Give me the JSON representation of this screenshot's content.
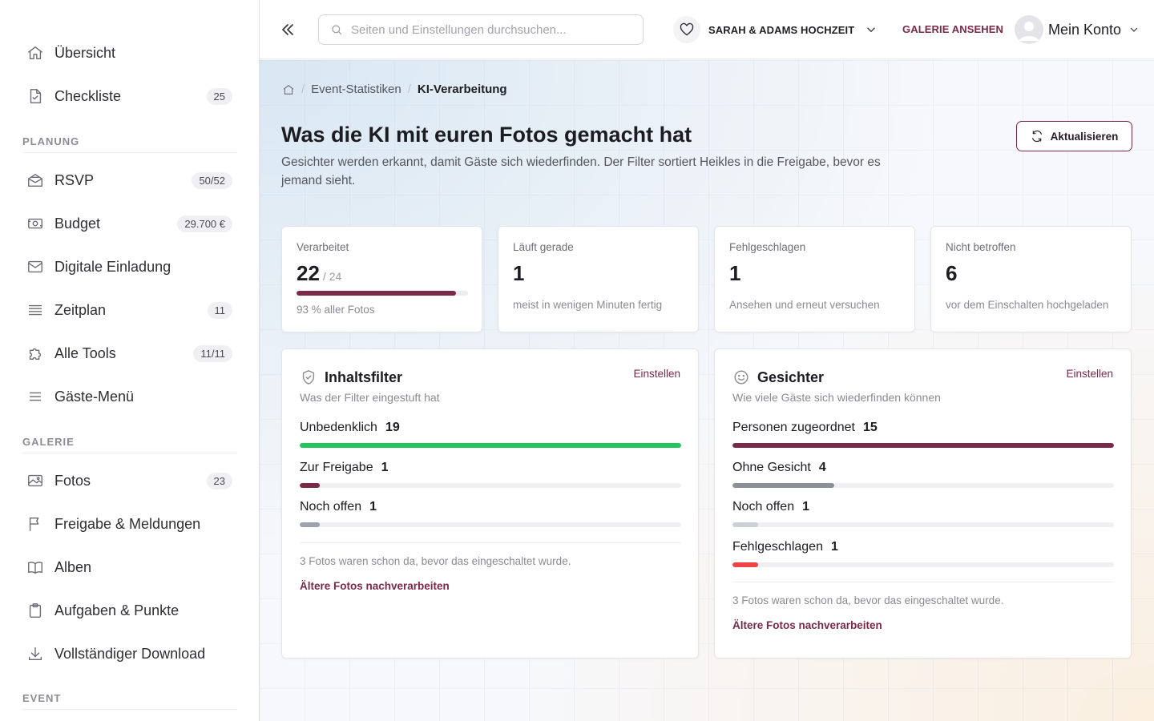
{
  "sidebar": {
    "items_top": [
      {
        "label": "Übersicht",
        "icon": "home-icon",
        "badge": ""
      },
      {
        "label": "Checkliste",
        "icon": "checklist-icon",
        "badge": "25"
      }
    ],
    "sections": [
      {
        "title": "PLANUNG",
        "items": [
          {
            "label": "RSVP",
            "icon": "envelope-open-icon",
            "badge": "50/52"
          },
          {
            "label": "Budget",
            "icon": "banknote-icon",
            "badge": "29.700 €"
          },
          {
            "label": "Digitale Einladung",
            "icon": "mail-icon",
            "badge": ""
          },
          {
            "label": "Zeitplan",
            "icon": "list-icon",
            "badge": "11"
          },
          {
            "label": "Alle Tools",
            "icon": "puzzle-icon",
            "badge": "11/11"
          },
          {
            "label": "Gäste-Menü",
            "icon": "menu-icon",
            "badge": ""
          }
        ]
      },
      {
        "title": "GALERIE",
        "items": [
          {
            "label": "Fotos",
            "icon": "image-icon",
            "badge": "23"
          },
          {
            "label": "Freigabe & Meldungen",
            "icon": "flag-icon",
            "badge": ""
          },
          {
            "label": "Alben",
            "icon": "book-open-icon",
            "badge": ""
          },
          {
            "label": "Aufgaben & Punkte",
            "icon": "clipboard-icon",
            "badge": ""
          },
          {
            "label": "Vollständiger Download",
            "icon": "download-icon",
            "badge": ""
          }
        ]
      },
      {
        "title": "EVENT",
        "items": []
      }
    ]
  },
  "topbar": {
    "search_placeholder": "Seiten und Einstellungen durchsuchen...",
    "event_name": "SARAH & ADAMS HOCHZEIT",
    "gallery_link": "GALERIE ANSEHEN",
    "account_label": "Mein Konto"
  },
  "breadcrumb": {
    "items": [
      "Event-Statistiken"
    ],
    "current": "KI-Verarbeitung"
  },
  "header": {
    "title": "Was die KI mit euren Fotos gemacht hat",
    "description": "Gesichter werden erkannt, damit Gäste sich wiederfinden. Der Filter sortiert Heikles in die Freigabe, bevor es jemand sieht.",
    "refresh_label": "Aktualisieren"
  },
  "stats": [
    {
      "label": "Verarbeitet",
      "value": "22",
      "sub": "/ 24",
      "progress": 0.93,
      "hint": "93 % aller Fotos"
    },
    {
      "label": "Läuft gerade",
      "value": "1",
      "hint": "meist in wenigen Minuten fertig"
    },
    {
      "label": "Fehlgeschlagen",
      "value": "1",
      "hint": "Ansehen und erneut versuchen"
    },
    {
      "label": "Nicht betroffen",
      "value": "6",
      "hint": "vor dem Einschalten hochgeladen"
    }
  ],
  "panels": {
    "filter": {
      "title": "Inhaltsfilter",
      "subtitle": "Was der Filter eingestuft hat",
      "link": "Einstellen",
      "icon": "shield-check-icon",
      "rows": [
        {
          "label": "Unbedenklich",
          "count": "19",
          "fraction": 1.0,
          "color": "#22c55e"
        },
        {
          "label": "Zur Freigabe",
          "count": "1",
          "fraction": 0.053,
          "color": "#7a2948"
        },
        {
          "label": "Noch offen",
          "count": "1",
          "fraction": 0.053,
          "color": "#9ca3af"
        }
      ],
      "note": "3 Fotos waren schon da, bevor das eingeschaltet wurde.",
      "action": "Ältere Fotos nachverarbeiten"
    },
    "faces": {
      "title": "Gesichter",
      "subtitle": "Wie viele Gäste sich wiederfinden können",
      "link": "Einstellen",
      "icon": "smiley-icon",
      "rows": [
        {
          "label": "Personen zugeordnet",
          "count": "15",
          "fraction": 1.0,
          "color": "#7a2948"
        },
        {
          "label": "Ohne Gesicht",
          "count": "4",
          "fraction": 0.267,
          "color": "#8a8f98"
        },
        {
          "label": "Noch offen",
          "count": "1",
          "fraction": 0.067,
          "color": "#cbd0d6"
        },
        {
          "label": "Fehlgeschlagen",
          "count": "1",
          "fraction": 0.067,
          "color": "#ef4444"
        }
      ],
      "note": "3 Fotos waren schon da, bevor das eingeschaltet wurde.",
      "action": "Ältere Fotos nachverarbeiten"
    }
  }
}
